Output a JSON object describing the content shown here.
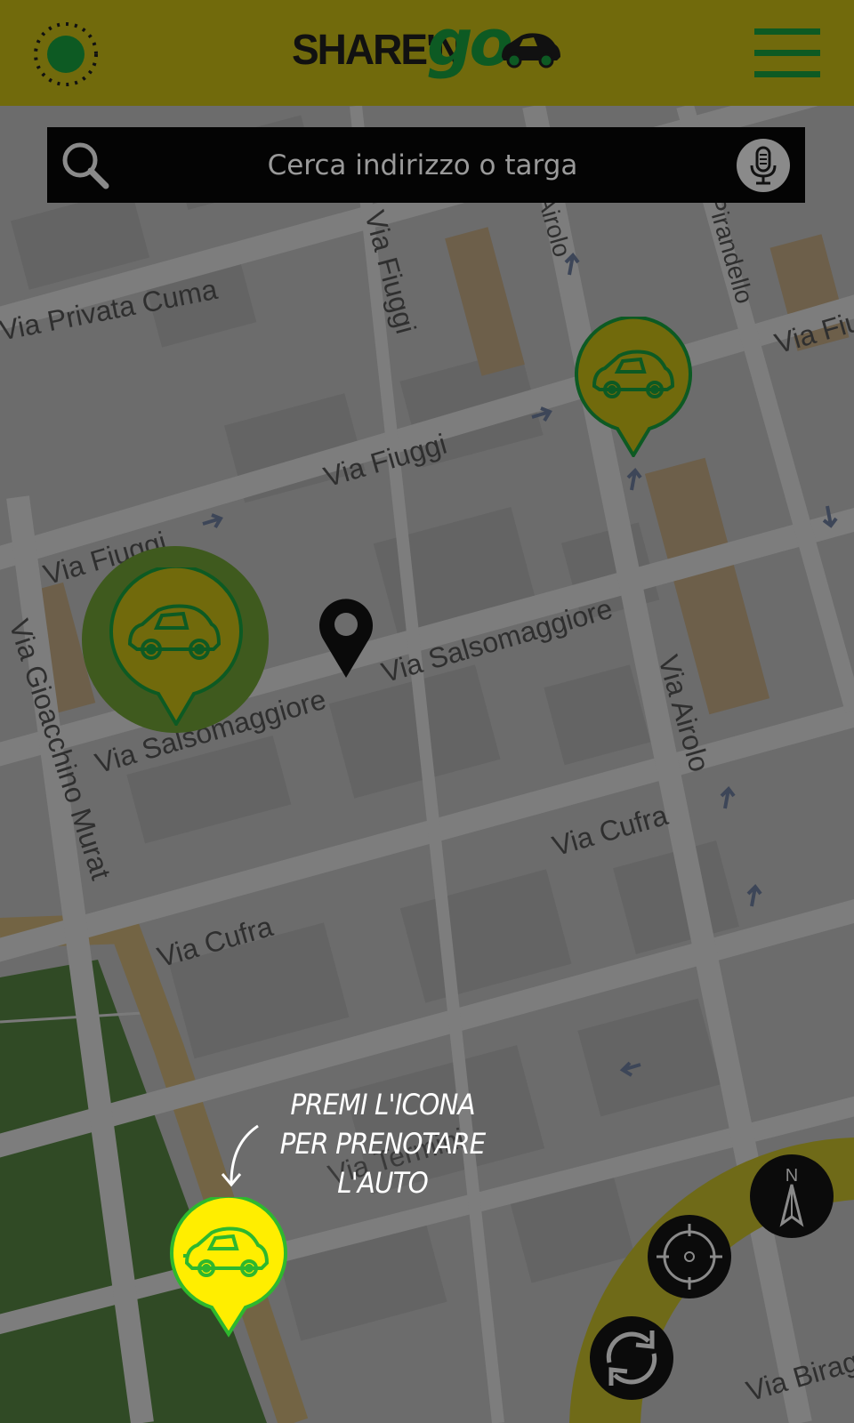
{
  "header": {
    "logo_share": "SHARE'N",
    "logo_go": "go",
    "status_icon": "status-indicator-icon",
    "menu_icon": "hamburger-menu-icon"
  },
  "search": {
    "placeholder": "Cerca indirizzo o targa",
    "search_icon": "search-icon",
    "mic_icon": "microphone-icon"
  },
  "map": {
    "streets": [
      "Via Privata Cuma",
      "Via Fiuggi",
      "Via Fiuggi",
      "Via Fiuggi",
      "Via Fiuggi",
      "Via Salsomaggiore",
      "Via Salsomaggiore",
      "Via Gioacchino Murat",
      "Via Airolo",
      "Via Cufra",
      "Via Cufra",
      "Via Termini",
      "Via Airolo",
      "Via Pirandello",
      "Via Biraghi"
    ],
    "cars": [
      "car-pin-icon",
      "car-pin-icon",
      "car-pin-icon"
    ],
    "location_marker": "location-pin-icon"
  },
  "tip": {
    "line1": "PREMI L'ICONA",
    "line2": "PER PRENOTARE",
    "line3": "L'AUTO"
  },
  "controls": {
    "compass_label": "N",
    "compass_icon": "compass-icon",
    "locate_icon": "crosshair-icon",
    "refresh_icon": "refresh-icon"
  },
  "colors": {
    "brand_yellow": "#FFEE00",
    "brand_green": "#0D5A23",
    "accent_green": "#2EB82E",
    "header_dimmed": "#716A0C"
  }
}
